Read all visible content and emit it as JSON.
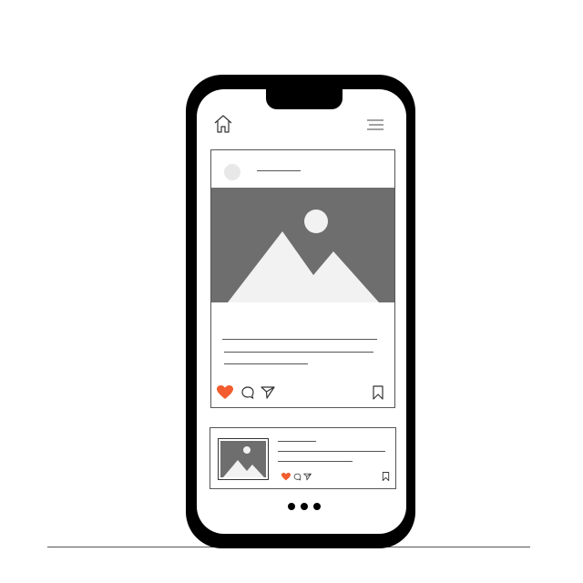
{
  "device": {
    "icons": {
      "home": "home-icon",
      "menu": "hamburger-menu-icon",
      "like": "heart-icon",
      "comment": "comment-icon",
      "share": "send-icon",
      "save": "bookmark-icon",
      "more": "more-dots-icon"
    },
    "colors": {
      "frame": "#000000",
      "image_placeholder": "#6e6e6e",
      "mountain": "#f2f2f2",
      "heart": "#f25c2e",
      "line": "#555555"
    },
    "page_indicator": {
      "dots": 3
    }
  }
}
